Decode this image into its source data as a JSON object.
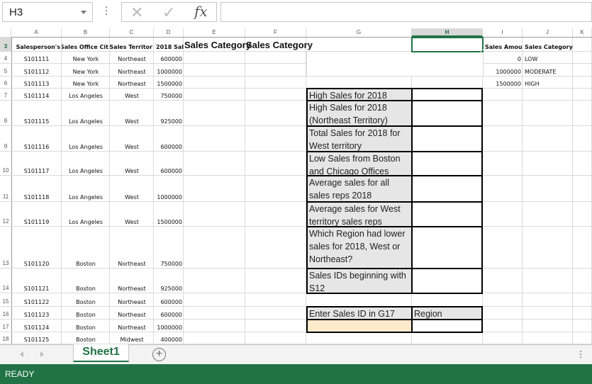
{
  "formula_bar": {
    "name_box": "H3",
    "cancel_icon": "✕",
    "enter_icon": "✓",
    "fx_label": "fx",
    "formula": ""
  },
  "columns": [
    "A",
    "B",
    "C",
    "D",
    "E",
    "F",
    "G",
    "H",
    "I",
    "J",
    "K"
  ],
  "selected_column": "H",
  "selected_cell": "H3",
  "rows": [
    "3",
    "4",
    "5",
    "6",
    "7",
    "8",
    "9",
    "10",
    "11",
    "12",
    "13",
    "14",
    "15",
    "16",
    "17",
    "18"
  ],
  "headers": {
    "A": "Salesperson's",
    "B": "Sales Office Cit",
    "C": "Sales Territor",
    "D": "2018 Sal",
    "E": "Sales Category",
    "F": "Sales Category",
    "I": "Sales Amou",
    "J": "Sales Category"
  },
  "data_rows": [
    {
      "row": "4",
      "id": "S101111",
      "city": "New York",
      "territory": "Northeast",
      "sales": "600000"
    },
    {
      "row": "5",
      "id": "S101112",
      "city": "New York",
      "territory": "Northeast",
      "sales": "1000000"
    },
    {
      "row": "6",
      "id": "S101113",
      "city": "New York",
      "territory": "Northeast",
      "sales": "1500000"
    },
    {
      "row": "7",
      "id": "S101114",
      "city": "Los Angeles",
      "territory": "West",
      "sales": "750000"
    },
    {
      "row": "8",
      "id": "S101115",
      "city": "Los Angeles",
      "territory": "West",
      "sales": "925000"
    },
    {
      "row": "9",
      "id": "S101116",
      "city": "Los Angeles",
      "territory": "West",
      "sales": "600000"
    },
    {
      "row": "10",
      "id": "S101117",
      "city": "Los Angeles",
      "territory": "West",
      "sales": "600000"
    },
    {
      "row": "11",
      "id": "S101118",
      "city": "Los Angeles",
      "territory": "West",
      "sales": "1000000"
    },
    {
      "row": "12",
      "id": "S101119",
      "city": "Los Angeles",
      "territory": "West",
      "sales": "1500000"
    },
    {
      "row": "13",
      "id": "S101120",
      "city": "Boston",
      "territory": "Northeast",
      "sales": "750000"
    },
    {
      "row": "14",
      "id": "S101121",
      "city": "Boston",
      "territory": "Northeast",
      "sales": "925000"
    },
    {
      "row": "15",
      "id": "S101122",
      "city": "Boston",
      "territory": "Northeast",
      "sales": "600000"
    },
    {
      "row": "16",
      "id": "S101123",
      "city": "Boston",
      "territory": "Northeast",
      "sales": "600000"
    },
    {
      "row": "17",
      "id": "S101124",
      "city": "Boston",
      "territory": "Northeast",
      "sales": "1000000"
    },
    {
      "row": "18",
      "id": "S101125",
      "city": "Boston",
      "territory": "Midwest",
      "sales": "400000"
    }
  ],
  "lookup_table": [
    {
      "amount": "0",
      "category": "LOW"
    },
    {
      "amount": "1000000",
      "category": "MODERATE"
    },
    {
      "amount": "1500000",
      "category": "HIGH"
    }
  ],
  "questions": [
    {
      "label": "High Sales for 2018",
      "answer": ""
    },
    {
      "label": "High Sales for 2018 (Northeast Territory)",
      "answer": ""
    },
    {
      "label": "Total Sales for 2018 for West territory",
      "answer": ""
    },
    {
      "label": "Low Sales from Boston and Chicago Offices",
      "answer": ""
    },
    {
      "label": "Average sales for all sales reps 2018",
      "answer": ""
    },
    {
      "label": "Average sales for West territory sales reps",
      "answer": ""
    },
    {
      "label": "Which Region had lower sales for 2018, West or Northeast?",
      "answer": ""
    },
    {
      "label": "Sales IDs beginning with S12",
      "answer": ""
    }
  ],
  "lookup_input": {
    "label": "Enter Sales ID in G17",
    "result_label": "Region",
    "input_value": "",
    "result_value": ""
  },
  "sheet_tabs": {
    "active": "Sheet1",
    "add_icon": "+"
  },
  "status_bar": {
    "mode": "READY"
  },
  "colors": {
    "excel_green": "#217346",
    "question_fill": "#e7e6e6",
    "input_fill": "#fde9cc"
  }
}
